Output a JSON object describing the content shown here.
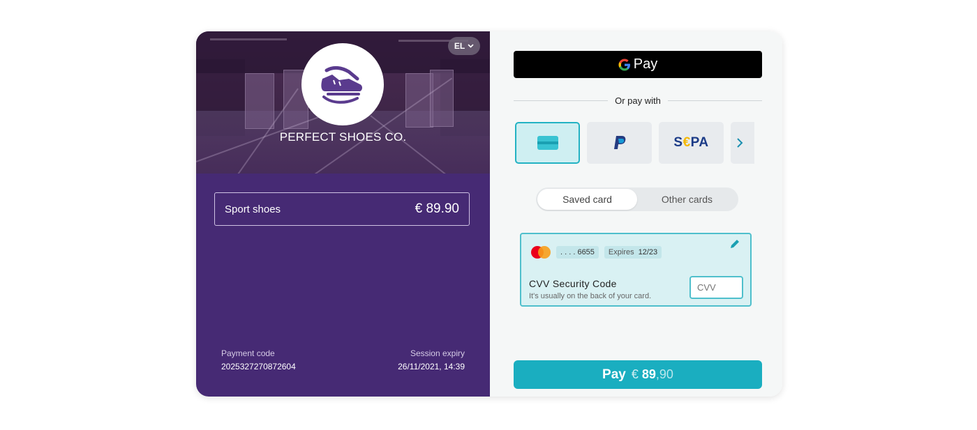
{
  "merchant": {
    "language": "EL",
    "name": "PERFECT SHOES CO."
  },
  "order": {
    "item_name": "Sport  shoes",
    "item_price": "€ 89.90"
  },
  "payment_info": {
    "payment_code_label": "Payment code",
    "payment_code_value": "2025327270872604",
    "session_expiry_label": "Session expiry",
    "session_expiry_value": "26/11/2021, 14:39"
  },
  "checkout": {
    "gpay_label": "Pay",
    "or_pay_with": "Or pay with",
    "methods": [
      {
        "name": "card",
        "icon": "credit-card-icon",
        "selected": true
      },
      {
        "name": "paypal",
        "icon": "paypal-icon"
      },
      {
        "name": "sepa",
        "label_left": "S",
        "label_euro": "€",
        "label_right": "PA"
      }
    ],
    "tabs": {
      "saved": "Saved card",
      "other": "Other cards"
    },
    "saved_card": {
      "masked_number": ". . . . 6655",
      "expires_label": "Expires",
      "expires_value": "12/23",
      "cvv_title": "CVV Security Code",
      "cvv_hint": "It's usually on the back of your card.",
      "cvv_placeholder": "CVV"
    },
    "pay_button": {
      "label": "Pay",
      "currency": "€",
      "amount_int": "89",
      "amount_dec": ",90"
    }
  },
  "colors": {
    "left_panel": "#462a74",
    "accent": "#1aaec0",
    "selected_border": "#23b2c3"
  }
}
